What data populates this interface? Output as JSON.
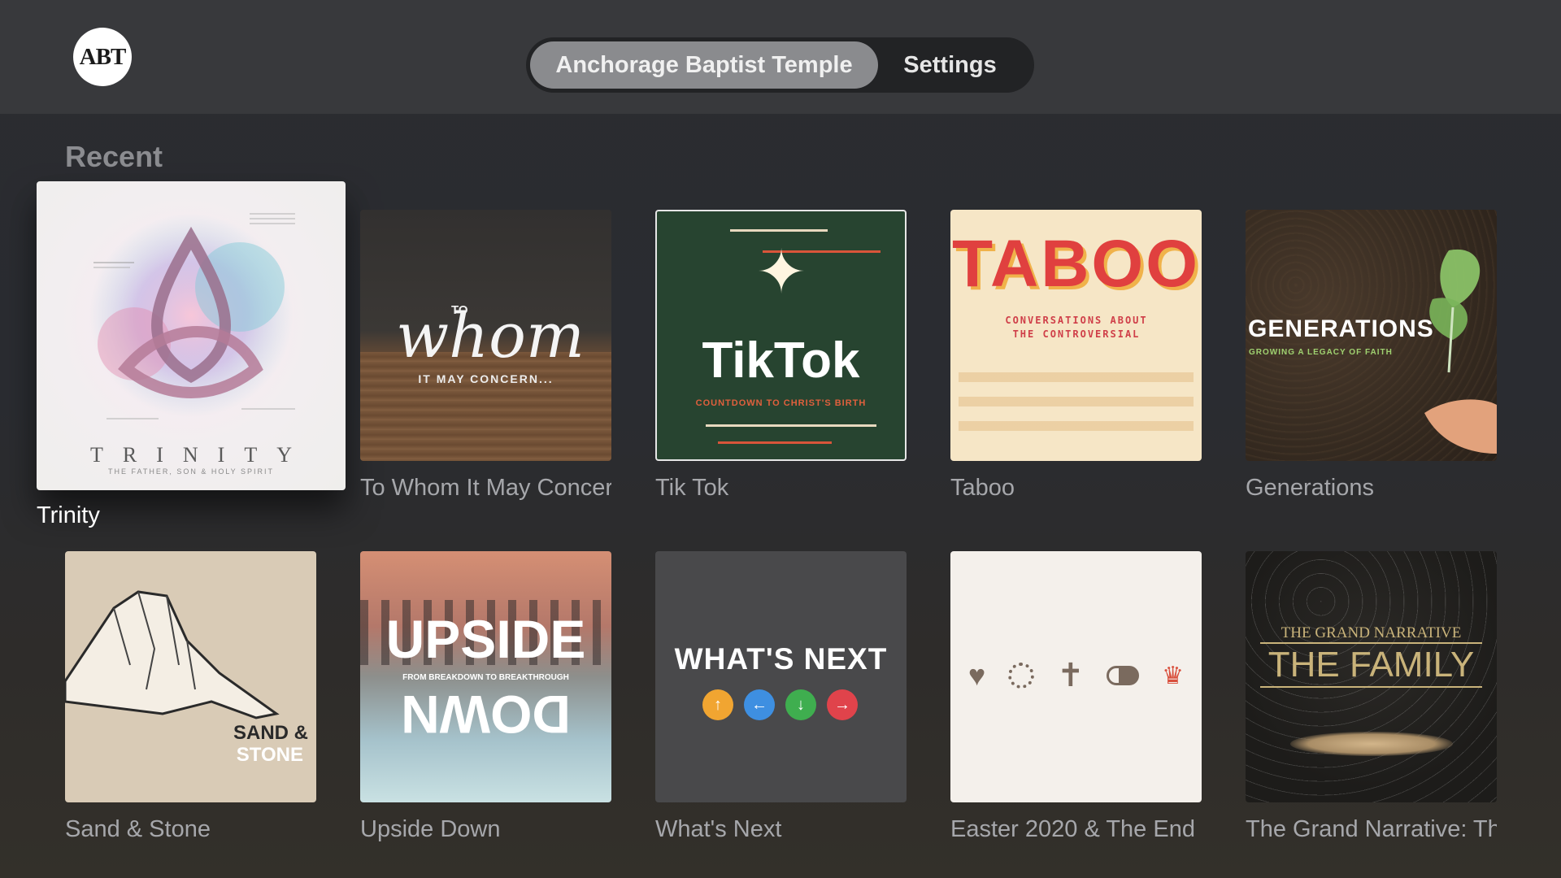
{
  "app": {
    "logo_text": "ABT",
    "tabs": [
      {
        "label": "Anchorage Baptist Temple",
        "active": true
      },
      {
        "label": "Settings",
        "active": false
      }
    ]
  },
  "section": {
    "title": "Recent"
  },
  "tiles": [
    {
      "title": "Trinity",
      "art": {
        "heading": "TRINITY",
        "sub": "THE FATHER, SON & HOLY SPIRIT"
      }
    },
    {
      "title": "To Whom It May Concern",
      "art": {
        "pre": "TO",
        "script": "whom",
        "sub": "IT MAY CONCERN..."
      }
    },
    {
      "title": "Tik Tok",
      "art": {
        "heading": "TikTok",
        "sub": "COUNTDOWN TO CHRIST'S BIRTH"
      }
    },
    {
      "title": "Taboo",
      "art": {
        "heading": "TABOO",
        "sub": "CONVERSATIONS ABOUT THE CONTROVERSIAL"
      }
    },
    {
      "title": "Generations",
      "art": {
        "heading": "GENERATIONS",
        "sub": "GROWING A LEGACY OF FAITH"
      }
    },
    {
      "title": "Sand & Stone",
      "art": {
        "line1": "SAND &",
        "line2": "STONE"
      }
    },
    {
      "title": "Upside Down",
      "art": {
        "heading": "UPSIDE",
        "sub": "FROM BREAKDOWN TO BREAKTHROUGH",
        "flipped": "DOWN"
      }
    },
    {
      "title": "What's Next",
      "art": {
        "heading": "WHAT'S NEXT"
      }
    },
    {
      "title": "Easter 2020 & The End",
      "art": {}
    },
    {
      "title": "The Grand Narrative: The Family",
      "art": {
        "pre": "THE GRAND NARRATIVE",
        "heading": "THE FAMILY"
      }
    }
  ],
  "colors": {
    "tiktok_bg": "#274430",
    "taboo_text": "#e0403f",
    "whats_next_bg": "#49494b",
    "grand_narrative_gold": "#c9b37a"
  }
}
